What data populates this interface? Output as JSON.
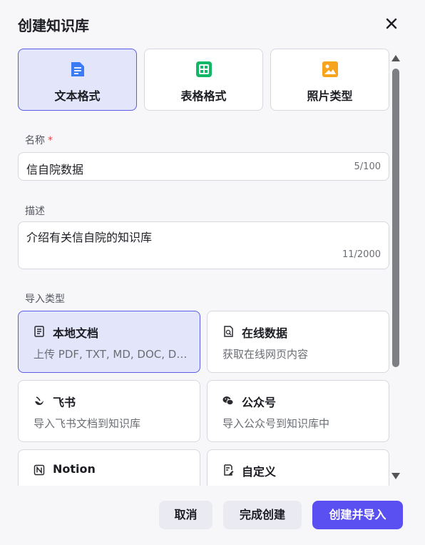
{
  "dialog": {
    "title": "创建知识库",
    "close_icon": "close-icon"
  },
  "formats": [
    {
      "label": "文本格式",
      "icon": "text-doc-icon",
      "color": "#3b7cf6",
      "selected": true
    },
    {
      "label": "表格格式",
      "icon": "table-icon",
      "color": "#12b765",
      "selected": false
    },
    {
      "label": "照片类型",
      "icon": "image-icon",
      "color": "#f6a41d",
      "selected": false
    }
  ],
  "name_field": {
    "label": "名称",
    "required_mark": "*",
    "value": "信自院数据",
    "counter": "5/100"
  },
  "desc_field": {
    "label": "描述",
    "value": "介绍有关信自院的知识库",
    "counter": "11/2000"
  },
  "import": {
    "label": "导入类型",
    "types": [
      {
        "title": "本地文档",
        "desc": "上传 PDF, TXT, MD, DOC, DOCX 格式的本地文件",
        "icon": "document-icon",
        "selected": true
      },
      {
        "title": "在线数据",
        "desc": "获取在线网页内容",
        "icon": "web-page-icon",
        "selected": false
      },
      {
        "title": "飞书",
        "desc": "导入飞书文档到知识库",
        "icon": "feishu-icon",
        "selected": false
      },
      {
        "title": "公众号",
        "desc": "导入公众号到知识库中",
        "icon": "wechat-icon",
        "selected": false
      },
      {
        "title": "Notion",
        "desc": "",
        "icon": "notion-icon",
        "selected": false
      },
      {
        "title": "自定义",
        "desc": "",
        "icon": "custom-edit-icon",
        "selected": false
      }
    ]
  },
  "footer": {
    "cancel": "取消",
    "finish": "完成创建",
    "create_import": "创建并导入"
  },
  "colors": {
    "accent": "#5a4ff0",
    "selected_bg": "#e3e5fb",
    "selected_border": "#5a5de8"
  }
}
